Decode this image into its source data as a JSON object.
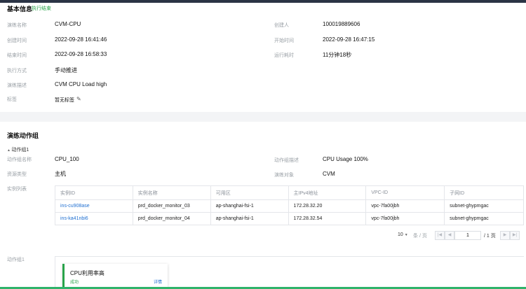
{
  "basic_info": {
    "title": "基本信息",
    "status": "执行结束",
    "fields_left": [
      {
        "label": "演练名称",
        "value": "CVM-CPU"
      },
      {
        "label": "创建时间",
        "value": "2022-09-28 16:41:46"
      },
      {
        "label": "结束时间",
        "value": "2022-09-28 16:58:33"
      },
      {
        "label": "执行方式",
        "value": "手动推进"
      },
      {
        "label": "演练描述",
        "value": "CVM CPU Load high"
      },
      {
        "label": "标签",
        "value": "暂无标签"
      }
    ],
    "fields_right": [
      {
        "label": "创建人",
        "value": "100019889606"
      },
      {
        "label": "开始时间",
        "value": "2022-09-28 16:47:15"
      },
      {
        "label": "运行耗时",
        "value": "11分钟18秒"
      }
    ]
  },
  "action_groups": {
    "title": "演练动作组",
    "group_toggle": "动作组1",
    "fields": {
      "group_name_label": "动作组名称",
      "group_name_value": "CPU_100",
      "group_desc_label": "动作组描述",
      "group_desc_value": "CPU Usage 100%",
      "resource_type_label": "资源类型",
      "resource_type_value": "主机",
      "target_label": "演练对象",
      "target_value": "CVM",
      "instance_list_label": "实例列表"
    },
    "table": {
      "headers": [
        "实例ID",
        "实例名称",
        "可用区",
        "主IPv4地址",
        "VPC-ID",
        "子网ID"
      ],
      "rows": [
        [
          "ins-cu908ase",
          "prd_docker_monitor_03",
          "ap-shanghai-fsi-1",
          "172.28.32.20",
          "vpc-7fa00jbh",
          "subnet-ghypmgac"
        ],
        [
          "ins-ka41nbi6",
          "prd_docker_monitor_04",
          "ap-shanghai-fsi-1",
          "172.28.32.54",
          "vpc-7fa00jbh",
          "subnet-ghypmgac"
        ]
      ]
    },
    "pager": {
      "page_size": "10",
      "unit": "条 / 页",
      "current_page": "1",
      "total": "/ 1 页"
    },
    "action_label": "动作组1",
    "action_card": {
      "name": "CPU利用率高",
      "status": "成功",
      "detail_link": "详情"
    }
  },
  "colors": {
    "success": "#29a34a",
    "link": "#1f6fd1",
    "label": "#9aa0a6"
  }
}
